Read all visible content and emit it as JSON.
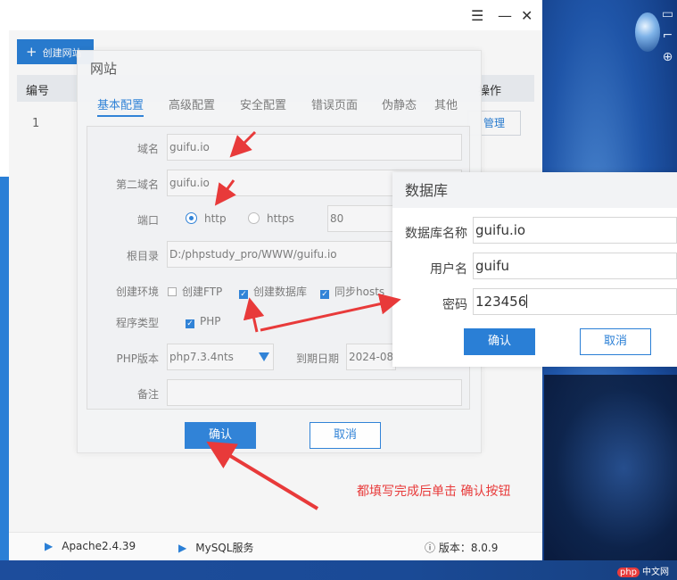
{
  "app": {
    "toolbar": {
      "create_site": "创建网站"
    },
    "table": {
      "col_id": "编号",
      "col_op": "操作",
      "row_id": "1",
      "manage": "管理"
    },
    "status": {
      "apache": "Apache2.4.39",
      "mysql": "MySQL服务",
      "version": "版本：8.0.9"
    }
  },
  "website_dialog": {
    "title": "网站",
    "tabs": [
      "基本配置",
      "高级配置",
      "安全配置",
      "错误页面",
      "伪静态",
      "其他"
    ],
    "fields": {
      "domain_label": "域名",
      "domain_value": "guifu.io",
      "second_domain_label": "第二域名",
      "second_domain_value": "guifu.io",
      "port_label": "端口",
      "port_http": "http",
      "port_https": "https",
      "port_value": "80",
      "root_label": "根目录",
      "root_value": "D:/phpstudy_pro/WWW/guifu.io",
      "env_label": "创建环境",
      "env_ftp": "创建FTP",
      "env_db": "创建数据库",
      "env_hosts": "同步hosts",
      "prog_label": "程序类型",
      "prog_php": "PHP",
      "php_label": "PHP版本",
      "php_value": "php7.3.4nts",
      "expire_label": "到期日期",
      "expire_value": "2024-08-",
      "note_label": "备注"
    },
    "confirm": "确认",
    "cancel": "取消"
  },
  "db_dialog": {
    "title": "数据库",
    "name_label": "数据库名称",
    "name_value": "guifu.io",
    "user_label": "用户名",
    "user_value": "guifu",
    "pass_label": "密码",
    "pass_value": "123456",
    "confirm": "确认",
    "cancel": "取消"
  },
  "annotation": "都填写完成后单击  确认按钮",
  "watermark": {
    "badge": "php",
    "text": "中文网"
  },
  "colors": {
    "accent": "#2a7fd6",
    "annotation": "#e83a3a"
  }
}
